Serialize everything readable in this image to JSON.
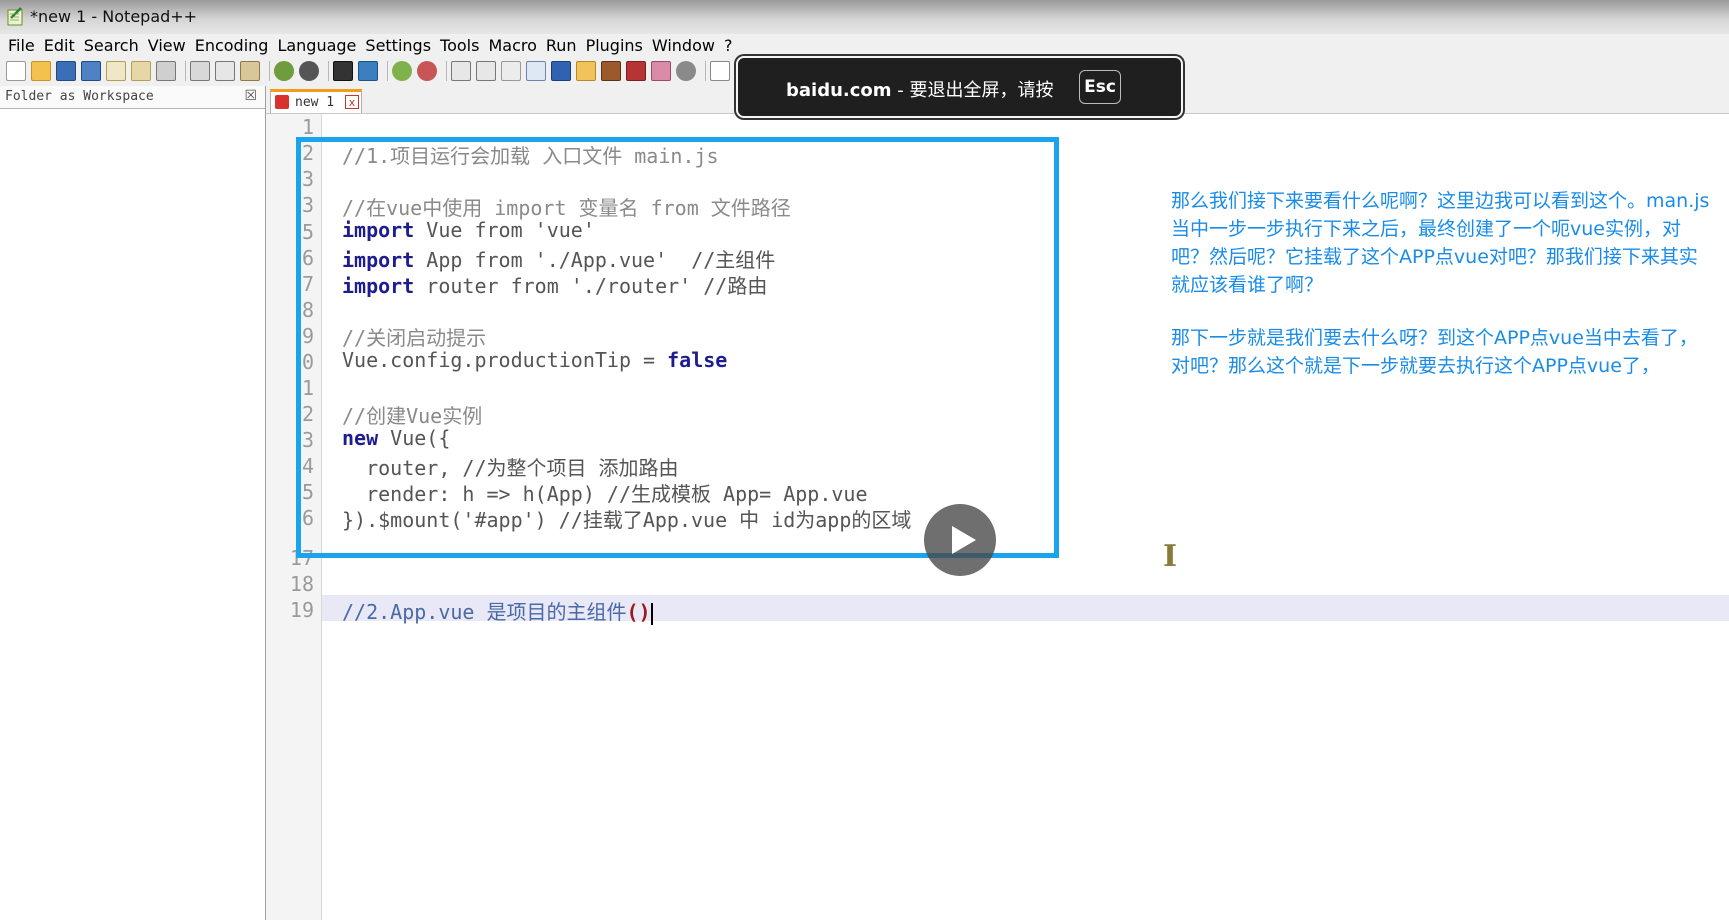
{
  "window": {
    "title": "*new 1 - Notepad++"
  },
  "menu": [
    "File",
    "Edit",
    "Search",
    "View",
    "Encoding",
    "Language",
    "Settings",
    "Tools",
    "Macro",
    "Run",
    "Plugins",
    "Window",
    "?"
  ],
  "toolbar": {
    "icons": [
      "new-file-icon",
      "open-file-icon",
      "save-icon",
      "save-all-icon",
      "close-icon",
      "close-all-icon",
      "print-icon",
      "cut-icon",
      "copy-icon",
      "paste-icon",
      "undo-icon",
      "redo-icon",
      "find-icon",
      "replace-icon",
      "zoom-in-icon",
      "zoom-out-icon",
      "sync-v-icon",
      "sync-h-icon",
      "word-wrap-icon",
      "show-all-chars-icon",
      "indent-guide-icon",
      "user-lang-icon",
      "doc-map-icon",
      "function-list-icon",
      "folder-workspace-icon",
      "monitor-icon",
      "record-macro-icon"
    ]
  },
  "left_panel": {
    "title": "Folder as Workspace",
    "close": "☒"
  },
  "tab": {
    "label": "new 1",
    "close": "☒"
  },
  "fullscreen_banner": {
    "domain": "baidu.com",
    "message": " - 要退出全屏，请按",
    "key": "Esc"
  },
  "editor": {
    "line_numbers": [
      "1",
      "2",
      "3",
      "4",
      "5",
      "6",
      "7",
      "8",
      "9",
      "0",
      "1",
      "2",
      "3",
      "4",
      "5",
      "6",
      "17",
      "18",
      "19"
    ],
    "lines": {
      "l2": "//1.项目运行会加载 入口文件 main.js",
      "l4": "//在vue中使用 import 变量名 from 文件路径",
      "l5_kw": "import",
      "l5_rest": " Vue from 'vue'",
      "l6_kw": "import",
      "l6_rest": " App from './App.vue'  //主组件",
      "l7_kw": "import",
      "l7_rest": " router from './router' //路由",
      "l9": "//关闭启动提示",
      "l10_a": "Vue.config.productionTip = ",
      "l10_kw": "false",
      "l12": "//创建Vue实例",
      "l13_kw": "new",
      "l13_rest": " Vue({",
      "l14": "  router, //为整个项目 添加路由",
      "l15": "  render: h => h(App) //生成模板 App= App.vue",
      "l16": "}).$mount('#app') //挂载了App.vue 中 id为app的区域",
      "l19_cmt": "//2.App.vue 是项目的主组件",
      "l19_brace": "()"
    }
  },
  "subtitles": {
    "p1": "那么我们接下来要看什么呢啊？这里边我可以看到这个。man.js当中一步一步执行下来之后，最终创建了一个呃vue实例，对吧？然后呢？它挂载了这个APP点vue对吧？那我们接下来其实就应该看谁了啊？",
    "p2": "那下一步就是我们要去什么呀？到这个APP点vue当中去看了，对吧？那么这个就是下一步就要去执行这个APP点vue了，"
  },
  "colors": {
    "highlight": "#1ba4ee",
    "subtitle": "#1a8ce8",
    "tab_accent": "#f39c1b"
  }
}
